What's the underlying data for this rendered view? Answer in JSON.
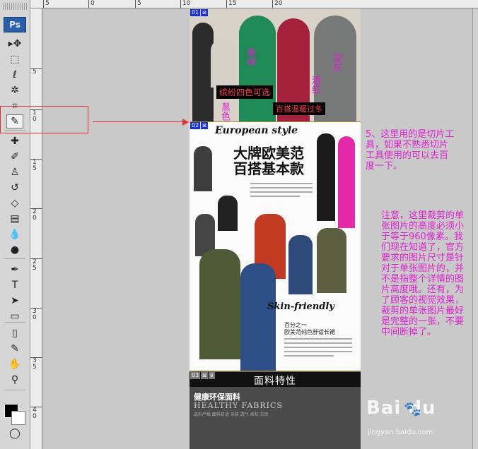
{
  "app": {
    "logo": "Ps"
  },
  "toolbar": {
    "tools": [
      {
        "name": "move-tool",
        "glyph": "▸✥"
      },
      {
        "name": "marquee-tool",
        "glyph": "⬚"
      },
      {
        "name": "lasso-tool",
        "glyph": "ℓ"
      },
      {
        "name": "magic-wand-tool",
        "glyph": "✲"
      },
      {
        "name": "crop-tool",
        "glyph": "⌗"
      },
      {
        "name": "slice-select-tool",
        "glyph": "✎"
      },
      {
        "name": "healing-brush-tool",
        "glyph": "✚"
      },
      {
        "name": "brush-tool",
        "glyph": "✐"
      },
      {
        "name": "clone-stamp-tool",
        "glyph": "♙"
      },
      {
        "name": "history-brush-tool",
        "glyph": "↺"
      },
      {
        "name": "eraser-tool",
        "glyph": "◇"
      },
      {
        "name": "gradient-tool",
        "glyph": "▤"
      },
      {
        "name": "blur-tool",
        "glyph": "💧"
      },
      {
        "name": "dodge-tool",
        "glyph": "●"
      },
      {
        "name": "pen-tool",
        "glyph": "✒"
      },
      {
        "name": "type-tool",
        "glyph": "T"
      },
      {
        "name": "path-selection-tool",
        "glyph": "➤"
      },
      {
        "name": "shape-tool",
        "glyph": "▭"
      },
      {
        "name": "notes-tool",
        "glyph": "▯"
      },
      {
        "name": "eyedropper-tool",
        "glyph": "✎"
      },
      {
        "name": "hand-tool",
        "glyph": "✋"
      },
      {
        "name": "zoom-tool",
        "glyph": "⚲"
      }
    ],
    "selected_tool": "slice-select-tool",
    "quickmask_glyph": "◯"
  },
  "rulers": {
    "top": [
      "5",
      "0",
      "5",
      "10",
      "15",
      "20"
    ],
    "left": [
      "5",
      "1\n0",
      "1\n5",
      "2\n0",
      "2\n5",
      "3\n0",
      "3\n5",
      "4\n0",
      "4\n5"
    ]
  },
  "document": {
    "slices": [
      {
        "num": "01",
        "icon": "⊠"
      },
      {
        "num": "02",
        "icon": "⊠"
      },
      {
        "num": "03",
        "icon": "⊠",
        "extra": "8"
      }
    ],
    "banner": {
      "tags": [
        {
          "text": "墨绿",
          "color": "#e020d0"
        },
        {
          "text": "酒红",
          "color": "#e020d0"
        },
        {
          "text": "深灰",
          "color": "#e020d0"
        },
        {
          "text": "黑色",
          "color": "#e020d0"
        }
      ],
      "slogan_left": "缤纷四色可选",
      "slogan_right": "百搭温暖过冬"
    },
    "catalog": {
      "title_en": "European style",
      "title_cn_line1": "大牌欧美范",
      "title_cn_line2": "百搭基本款",
      "skin": "Skin-friendly",
      "skin_sub1": "百分之一",
      "skin_sub2": "欧美范纯色舒适长裙"
    },
    "fabric": {
      "bar_title": "面料特性",
      "title_cn": "健康环保面料",
      "title_en": "HEALTHY FABRICS",
      "subtitle": "选料严格 面料舒适 亲肤 透气 柔软 天然"
    }
  },
  "annotations": {
    "note1": "5、这里用的是切片工具，如果不熟悉切片工具使用的可以去百度一下。",
    "note2": "注意，这里裁剪的单张图片的高度必须小于等于960像素。我们现在知道了，官方要求的图片尺寸是针对于单张图片的，并不是指整个详情的图片高度哦。还有，为了顾客的视觉效果，裁剪的单张图片最好是完整的一张，不要中间断掉了。",
    "colors": {
      "note": "#e020d0",
      "marker": "#e03030"
    }
  },
  "watermark": {
    "logo": "Bai du",
    "paw": "🐾",
    "url": "jingyan.baidu.com"
  }
}
